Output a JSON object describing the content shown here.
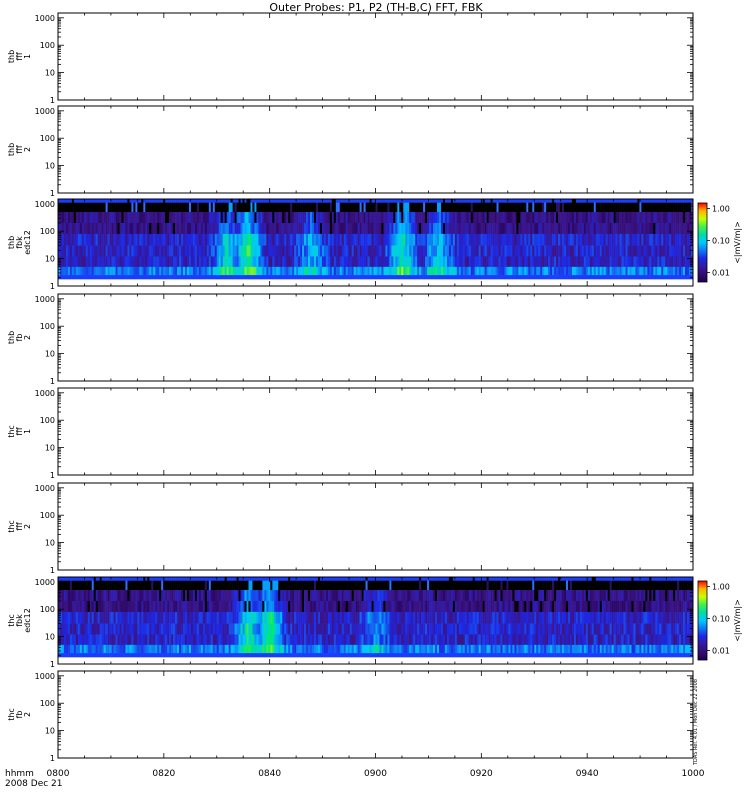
{
  "title": "Outer Probes: P1, P2 (TH-B,C) FFT, FBK",
  "time_axis": {
    "label_line1": "hhmm",
    "label_line2": "2008 Dec 21",
    "ticks": [
      "0800",
      "0820",
      "0840",
      "0900",
      "0920",
      "0940",
      "1000"
    ]
  },
  "y_ticks": [
    "1",
    "10",
    "100",
    "1000"
  ],
  "colorbar": {
    "ticks": [
      "1.00",
      "0.10",
      "0.01"
    ],
    "label": "<|mV/m|>"
  },
  "side_note": "TDAS Rel. 4.01 / Mon Dec 22 2008",
  "colors": {
    "low": "#1e0050",
    "mid": "#00e8ff",
    "high": "#ff0000",
    "band_top": "#1a3cff",
    "band_black": "#000000"
  },
  "chart_data": [
    {
      "type": "heatmap",
      "ylabel": [
        "thb",
        "fff",
        "1"
      ],
      "scale": "log",
      "ylim": [
        1,
        1500
      ],
      "has_data": false
    },
    {
      "type": "heatmap",
      "ylabel": [
        "thb",
        "fff",
        "2"
      ],
      "scale": "log",
      "ylim": [
        1,
        1500
      ],
      "has_data": false
    },
    {
      "type": "heatmap",
      "ylabel": [
        "thb",
        "fbk",
        "edc12"
      ],
      "scale": "log",
      "ylim": [
        1,
        1500
      ],
      "has_data": true,
      "colorbar_range": [
        0.005,
        1.5
      ],
      "bursts": [
        {
          "time": "0832",
          "level": 0.8
        },
        {
          "time": "0836",
          "level": 1.0
        },
        {
          "time": "0848",
          "level": 0.6
        },
        {
          "time": "0905",
          "level": 0.9
        },
        {
          "time": "0912",
          "level": 0.7
        }
      ]
    },
    {
      "type": "heatmap",
      "ylabel": [
        "thb",
        "fb",
        "2"
      ],
      "scale": "log",
      "ylim": [
        1,
        1500
      ],
      "has_data": false
    },
    {
      "type": "heatmap",
      "ylabel": [
        "thc",
        "fff",
        "1"
      ],
      "scale": "log",
      "ylim": [
        1,
        1500
      ],
      "has_data": false
    },
    {
      "type": "heatmap",
      "ylabel": [
        "thc",
        "fff",
        "2"
      ],
      "scale": "log",
      "ylim": [
        1,
        1500
      ],
      "has_data": false
    },
    {
      "type": "heatmap",
      "ylabel": [
        "thc",
        "fbk",
        "edc12"
      ],
      "scale": "log",
      "ylim": [
        1,
        1500
      ],
      "has_data": true,
      "colorbar_range": [
        0.005,
        1.5
      ],
      "bursts": [
        {
          "time": "0836",
          "level": 0.9
        },
        {
          "time": "0840",
          "level": 1.0
        },
        {
          "time": "0900",
          "level": 0.5
        }
      ]
    },
    {
      "type": "heatmap",
      "ylabel": [
        "thc",
        "fb",
        "2"
      ],
      "scale": "log",
      "ylim": [
        1,
        1500
      ],
      "has_data": false
    }
  ]
}
